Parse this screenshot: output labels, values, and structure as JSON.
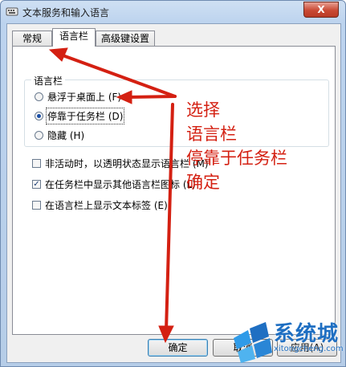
{
  "window": {
    "title": "文本服务和输入语言",
    "close_symbol": "X"
  },
  "tabs": [
    {
      "label": "常规",
      "active": false
    },
    {
      "label": "语言栏",
      "active": true
    },
    {
      "label": "高级键设置",
      "active": false
    }
  ],
  "language_bar_group": {
    "label": "语言栏",
    "options": [
      {
        "label": "悬浮于桌面上 (F)",
        "checked": false
      },
      {
        "label": "停靠于任务栏 (D)",
        "checked": true
      },
      {
        "label": "隐藏 (H)",
        "checked": false
      }
    ]
  },
  "checkboxes": [
    {
      "label": "非活动时，以透明状态显示语言栏 (M)",
      "checked": false
    },
    {
      "label": "在任务栏中显示其他语言栏图标 (L)",
      "checked": true
    },
    {
      "label": "在语言栏上显示文本标签 (E)",
      "checked": false
    }
  ],
  "buttons": {
    "ok": "确定",
    "cancel": "取消",
    "apply": "应用(A)"
  },
  "annotation": {
    "lines": [
      "选择",
      "语言栏",
      "停靠于任务栏",
      "确定"
    ],
    "color": "#d42012"
  },
  "watermark": {
    "name": "系统城",
    "url": "xitongcheng.com"
  }
}
